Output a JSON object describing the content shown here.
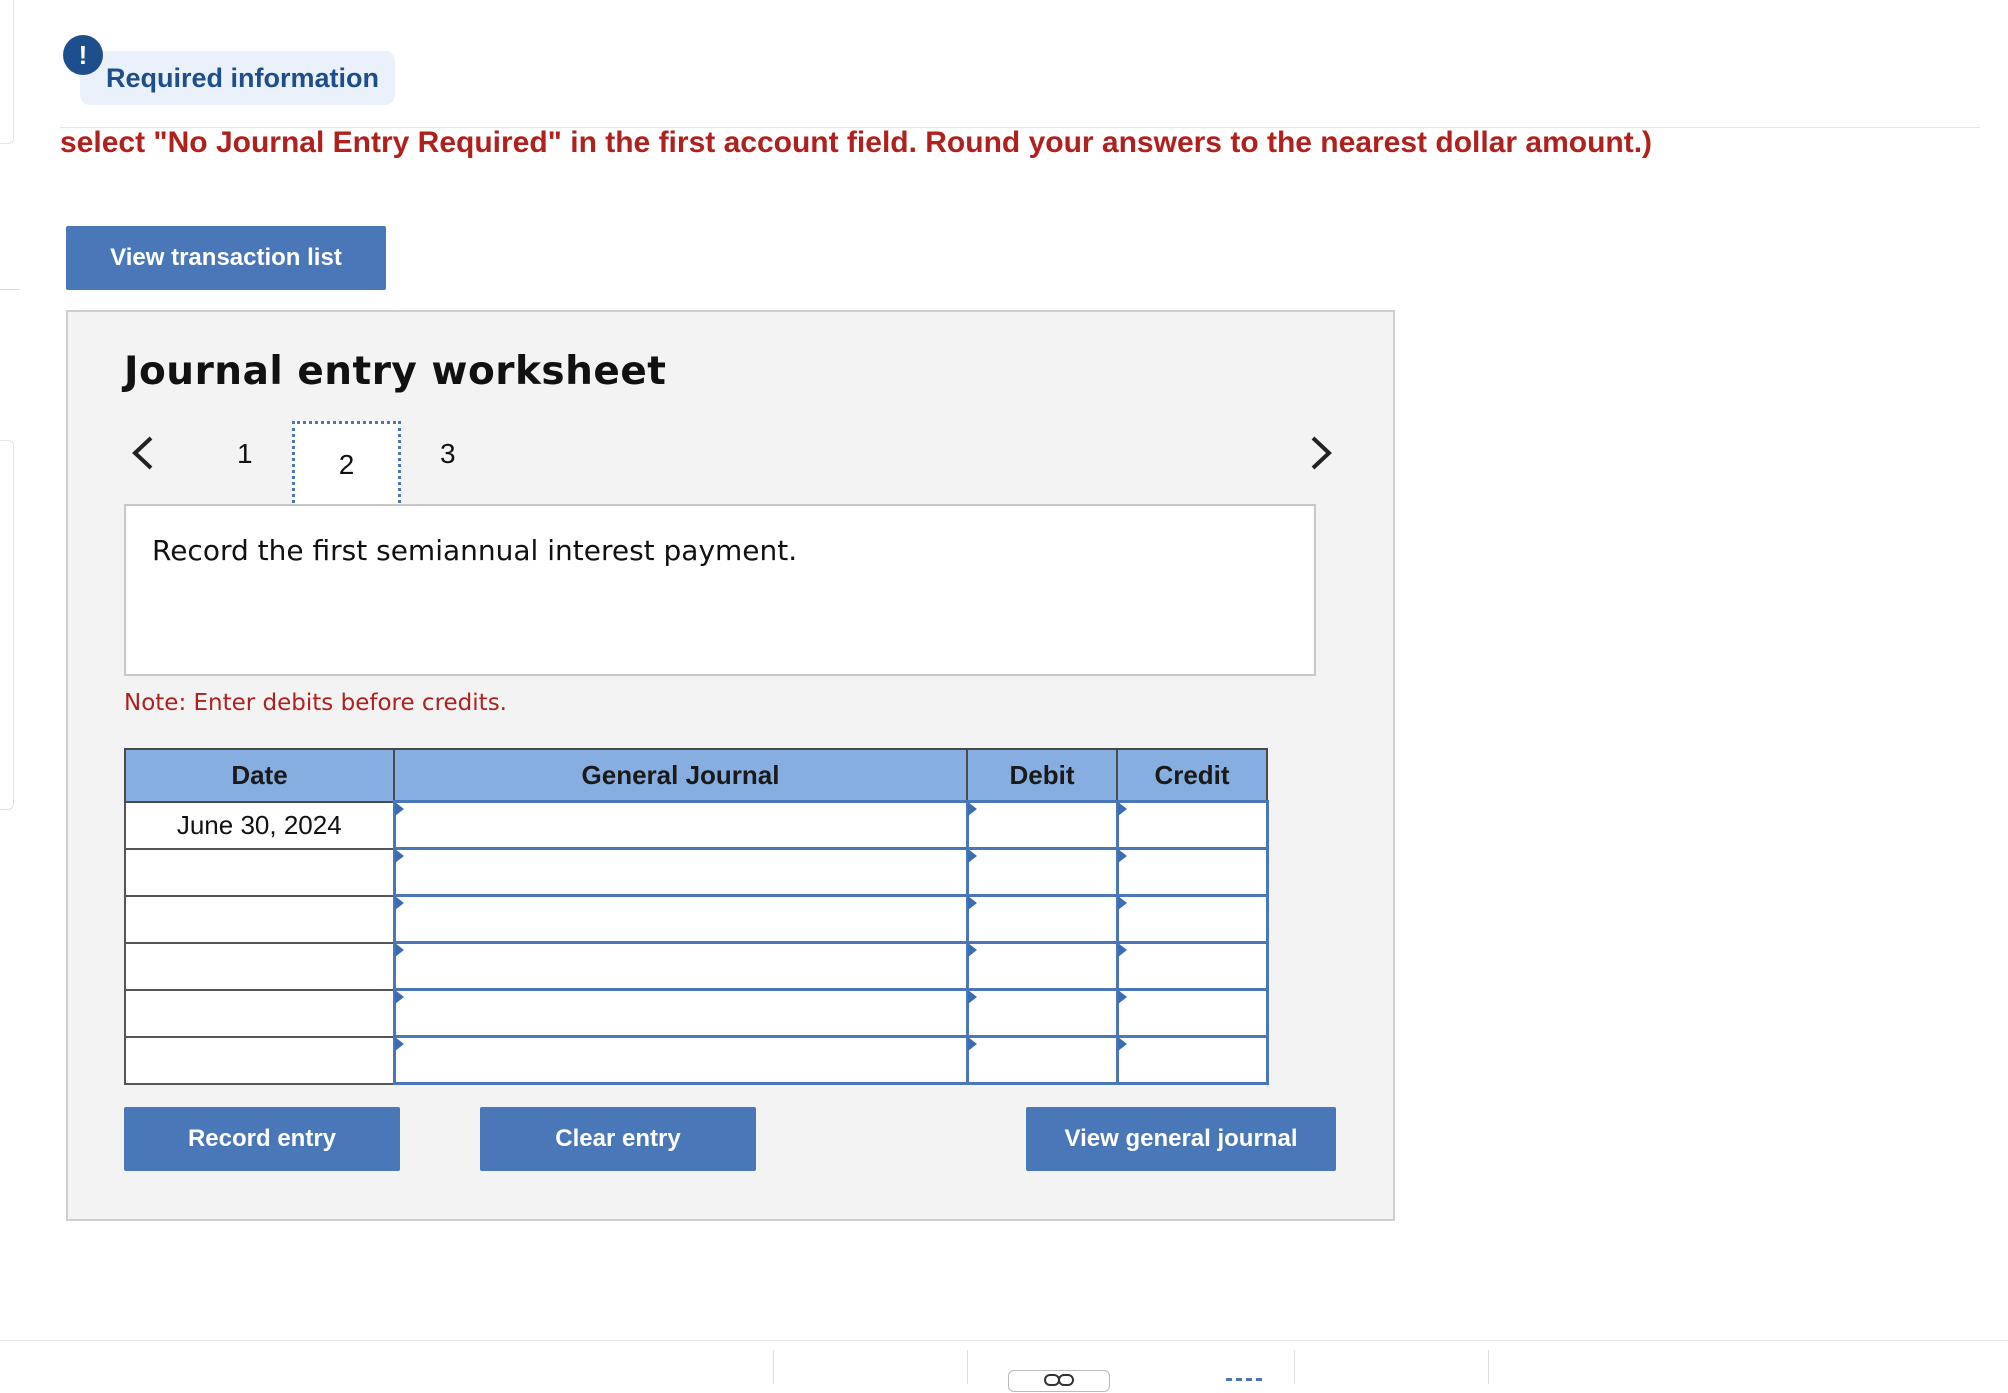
{
  "alert": {
    "icon": "!",
    "label": "Required information"
  },
  "instruction": "select \"No Journal Entry Required\" in the first account field. Round your answers to the nearest dollar amount.)",
  "view_transaction_button": "View transaction list",
  "worksheet": {
    "title": "Journal entry worksheet",
    "prev_icon": "<",
    "next_icon": ">",
    "tabs": [
      "1",
      "2",
      "3"
    ],
    "active_tab": "2",
    "description": "Record the first semiannual interest payment.",
    "note": "Note: Enter debits before credits."
  },
  "table": {
    "headers": {
      "date": "Date",
      "general_journal": "General Journal",
      "debit": "Debit",
      "credit": "Credit"
    },
    "rows": [
      {
        "date": "June 30, 2024",
        "account": "",
        "debit": "",
        "credit": ""
      },
      {
        "date": "",
        "account": "",
        "debit": "",
        "credit": ""
      },
      {
        "date": "",
        "account": "",
        "debit": "",
        "credit": ""
      },
      {
        "date": "",
        "account": "",
        "debit": "",
        "credit": ""
      },
      {
        "date": "",
        "account": "",
        "debit": "",
        "credit": ""
      },
      {
        "date": "",
        "account": "",
        "debit": "",
        "credit": ""
      }
    ]
  },
  "buttons": {
    "record_entry": "Record entry",
    "clear_entry": "Clear entry",
    "view_general_journal": "View general journal"
  },
  "colors": {
    "accent_blue": "#4a77b8",
    "header_blue": "#86aee0",
    "alert_red": "#b0201c",
    "navy": "#1f4e8c"
  }
}
